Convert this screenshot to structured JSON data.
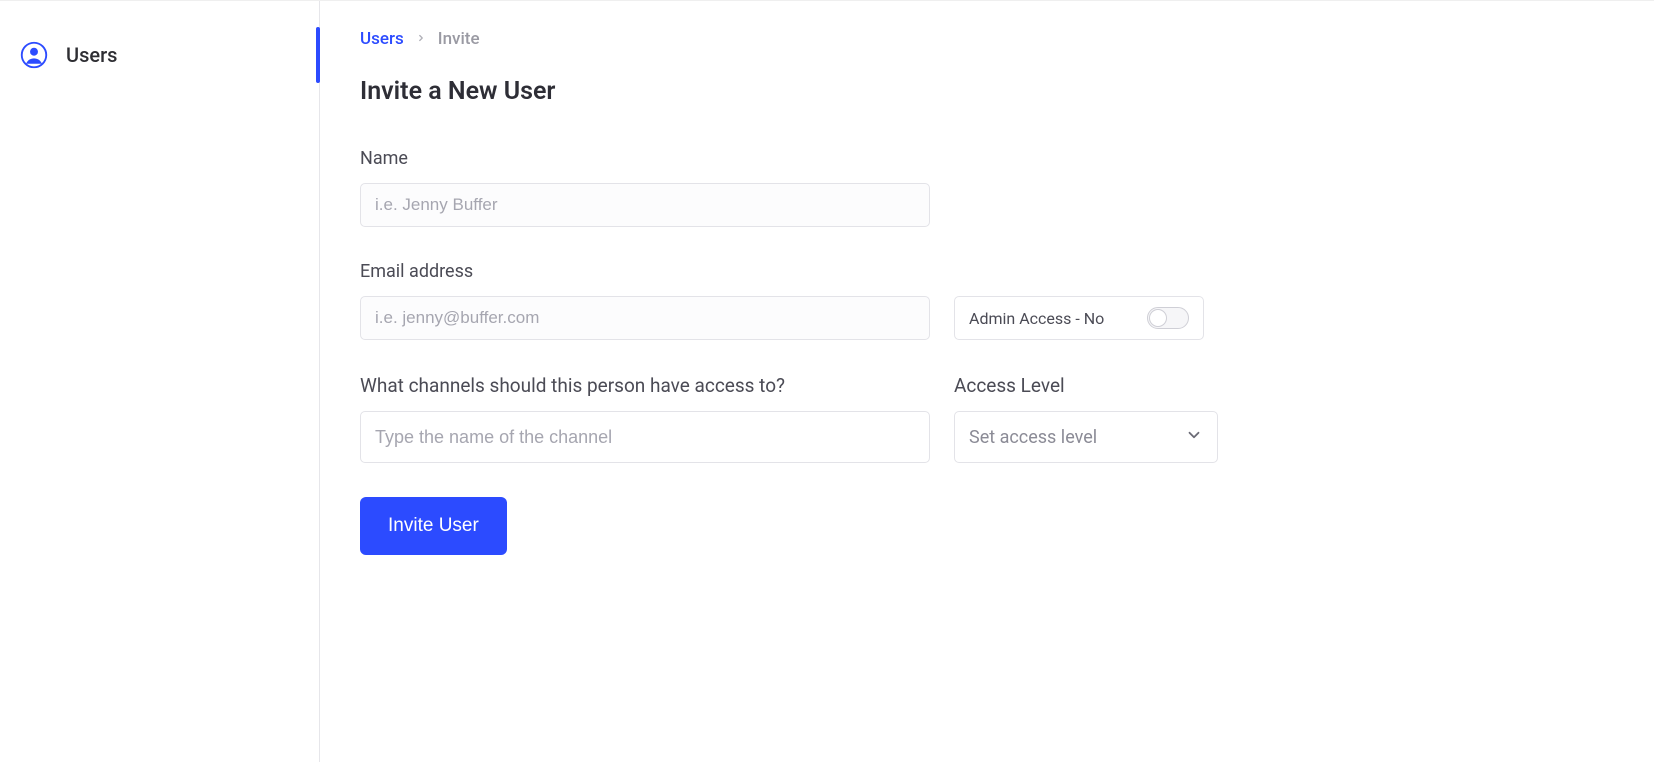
{
  "sidebar": {
    "items": [
      {
        "label": "Users"
      }
    ]
  },
  "breadcrumb": {
    "root": "Users",
    "current": "Invite"
  },
  "page": {
    "title": "Invite a New User"
  },
  "form": {
    "name_label": "Name",
    "name_placeholder": "i.e. Jenny Buffer",
    "email_label": "Email address",
    "email_placeholder": "i.e. jenny@buffer.com",
    "admin_access_label": "Admin Access - No",
    "channels_label": "What channels should this person have access to?",
    "channels_placeholder": "Type the name of the channel",
    "access_level_label": "Access Level",
    "access_level_placeholder": "Set access level",
    "submit_label": "Invite User"
  }
}
